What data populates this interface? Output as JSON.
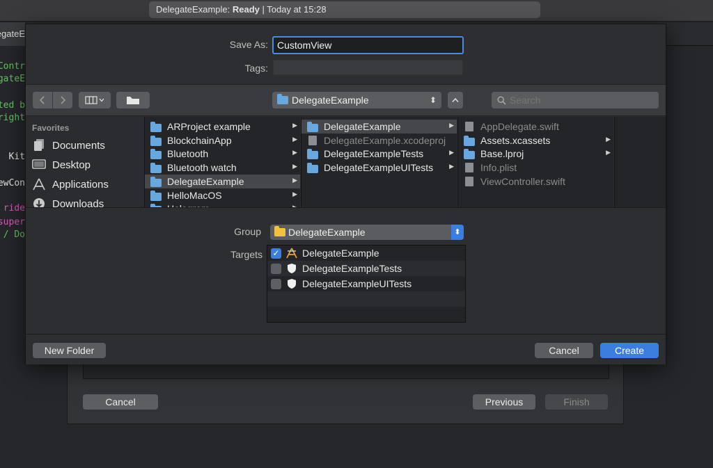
{
  "window": {
    "status_app": "DelegateExample:",
    "status_state": "Ready",
    "status_time": "| Today at 15:28",
    "tab_label": "DelegateE"
  },
  "code_lines": [
    {
      "text": "Contr",
      "color": "#6bc06b"
    },
    {
      "text": "DelegateE",
      "color": "#6bc06b"
    },
    {
      "text": "ted b",
      "color": "#6bc06b"
    },
    {
      "text": "right",
      "color": "#6bc06b"
    },
    {
      "text": "Kit",
      "color": "#e4e4e4"
    },
    {
      "text": "iewCon",
      "color": "#e4e4e4"
    },
    {
      "text": "ride",
      "color": "#d35fb5"
    },
    {
      "text": "super",
      "color": "#d35fb5"
    },
    {
      "text": "/ Do",
      "color": "#6bc06b"
    }
  ],
  "dialog": {
    "save_as_label": "Save As:",
    "save_as_value": "CustomView",
    "tags_label": "Tags:",
    "tags_value": "",
    "location": "DelegateExample",
    "search_placeholder": "Search",
    "favorites_label": "Favorites",
    "favorites": [
      {
        "label": "Documents",
        "icon": "documents-icon"
      },
      {
        "label": "Desktop",
        "icon": "desktop-icon"
      },
      {
        "label": "Applications",
        "icon": "applications-icon"
      },
      {
        "label": "Downloads",
        "icon": "downloads-icon"
      }
    ],
    "column1": [
      {
        "label": "ARProject example",
        "selected": false
      },
      {
        "label": "BlockchainApp",
        "selected": false
      },
      {
        "label": "Bluetooth",
        "selected": false
      },
      {
        "label": "Bluetooth watch",
        "selected": false
      },
      {
        "label": "DelegateExample",
        "selected": true
      },
      {
        "label": "HelloMacOS",
        "selected": false
      },
      {
        "label": "Hologram",
        "selected": false
      }
    ],
    "column2": [
      {
        "label": "DelegateExample",
        "type": "folder",
        "selected": true,
        "dim": false,
        "arrow": true
      },
      {
        "label": "DelegateExample.xcodeproj",
        "type": "file",
        "selected": false,
        "dim": true,
        "arrow": false
      },
      {
        "label": "DelegateExampleTests",
        "type": "folder",
        "selected": false,
        "dim": false,
        "arrow": true
      },
      {
        "label": "DelegateExampleUITests",
        "type": "folder",
        "selected": false,
        "dim": false,
        "arrow": true
      }
    ],
    "column3": [
      {
        "label": "AppDelegate.swift",
        "type": "file",
        "dim": true,
        "arrow": false
      },
      {
        "label": "Assets.xcassets",
        "type": "folder",
        "dim": false,
        "arrow": true
      },
      {
        "label": "Base.lproj",
        "type": "folder",
        "dim": false,
        "arrow": true
      },
      {
        "label": "Info.plist",
        "type": "file",
        "dim": true,
        "arrow": false
      },
      {
        "label": "ViewController.swift",
        "type": "file",
        "dim": true,
        "arrow": false
      }
    ],
    "group_label": "Group",
    "group_value": "DelegateExample",
    "targets_label": "Targets",
    "targets": [
      {
        "label": "DelegateExample",
        "checked": true,
        "icon": "app-target-icon"
      },
      {
        "label": "DelegateExampleTests",
        "checked": false,
        "icon": "test-target-icon"
      },
      {
        "label": "DelegateExampleUITests",
        "checked": false,
        "icon": "test-target-icon"
      }
    ],
    "new_folder_label": "New Folder",
    "cancel_label": "Cancel",
    "create_label": "Create"
  },
  "wizard": {
    "cancel_label": "Cancel",
    "previous_label": "Previous",
    "finish_label": "Finish"
  }
}
